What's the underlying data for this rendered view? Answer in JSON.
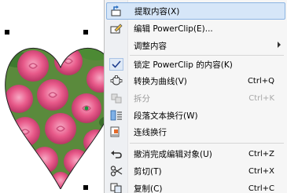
{
  "menu": {
    "items": [
      {
        "label": "提取内容(X)",
        "icon": "extract-contents-icon"
      },
      {
        "label": "编辑 PowerClip(E)...",
        "icon": "edit-powerclip-icon"
      },
      {
        "label": "调整内容",
        "icon": ""
      },
      {
        "label": "锁定 PowerClip 的内容(K)",
        "icon": "checkmark-icon"
      },
      {
        "label": "转换为曲线(V)",
        "shortcut": "Ctrl+Q",
        "icon": "convert-to-curves-icon"
      },
      {
        "label": "拆分",
        "shortcut": "Ctrl+K",
        "icon": "break-apart-icon"
      },
      {
        "label": "段落文本换行(W)",
        "icon": "paragraph-wrap-icon"
      },
      {
        "label": "连线换行",
        "icon": "link-wrap-icon"
      },
      {
        "label": "撤消完成编辑对象(U)",
        "shortcut": "Ctrl+Z",
        "icon": "undo-icon"
      },
      {
        "label": "剪切(T)",
        "shortcut": "Ctrl+X",
        "icon": "scissors-icon"
      },
      {
        "label": "复制(C)",
        "shortcut": "Ctrl+C",
        "icon": "copy-icon"
      }
    ]
  },
  "colors": {
    "highlight": "#d6e6f8",
    "rose": "#e85a8a",
    "leaf": "#3f7a2f"
  }
}
